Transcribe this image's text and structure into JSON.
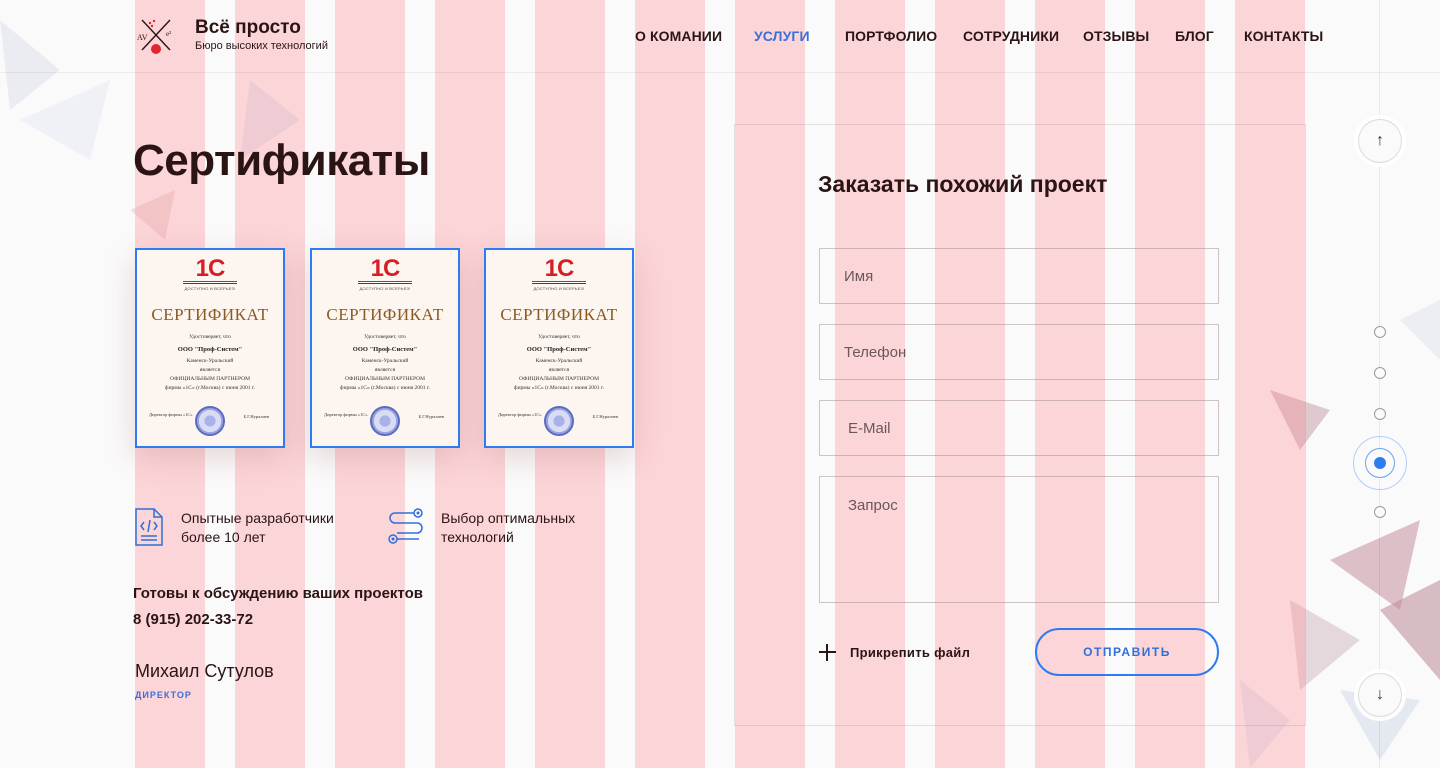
{
  "brand": {
    "title": "Всё просто",
    "subtitle": "Бюро высоких технологий"
  },
  "nav": {
    "items": [
      {
        "label": "О КОМАНИИ",
        "active": false
      },
      {
        "label": "УСЛУГИ",
        "active": true
      },
      {
        "label": "ПОРТФОЛИО",
        "active": false
      },
      {
        "label": "СОТРУДНИКИ",
        "active": false
      },
      {
        "label": "ОТЗЫВЫ",
        "active": false
      },
      {
        "label": "БЛОГ",
        "active": false
      },
      {
        "label": "КОНТАКТЫ",
        "active": false
      }
    ]
  },
  "page": {
    "title": "Сертификаты"
  },
  "certificates": [
    {
      "logo": "1С",
      "tagline": "ДОСТУПНО И ВСЕРЬЕЗ!",
      "heading": "СЕРТИФИКАТ",
      "line1": "Удостоверяет, что",
      "company": "ООО \"Проф-Систем\"",
      "city": "Каменск-Уральский",
      "line2": "является",
      "status": "ОФИЦИАЛЬНЫМ ПАРТНЕРОМ",
      "line3": "фирмы «1С» (г.Москва) с июня 2001 г.",
      "signer_role": "Директор фирмы «1С»",
      "signer_name": "Б.Г.Нуралиев"
    },
    {
      "logo": "1С",
      "tagline": "ДОСТУПНО И ВСЕРЬЕЗ!",
      "heading": "СЕРТИФИКАТ",
      "line1": "Удостоверяет, что",
      "company": "ООО \"Проф-Систем\"",
      "city": "Каменск-Уральский",
      "line2": "является",
      "status": "ОФИЦИАЛЬНЫМ ПАРТНЕРОМ",
      "line3": "фирмы «1С» (г.Москва) с июня 2001 г.",
      "signer_role": "Директор фирмы «1С»",
      "signer_name": "Б.Г.Нуралиев"
    },
    {
      "logo": "1С",
      "tagline": "ДОСТУПНО И ВСЕРЬЕЗ!",
      "heading": "СЕРТИФИКАТ",
      "line1": "Удостоверяет, что",
      "company": "ООО \"Проф-Систем\"",
      "city": "Каменск-Уральский",
      "line2": "является",
      "status": "ОФИЦИАЛЬНЫМ ПАРТНЕРОМ",
      "line3": "фирмы «1С» (г.Москва) с июня 2001 г.",
      "signer_role": "Директор фирмы «1С»",
      "signer_name": "Б.Г.Нуралиев"
    }
  ],
  "features": [
    {
      "icon": "code-document-icon",
      "line1": "Опытные разработчики",
      "line2": "более 10 лет"
    },
    {
      "icon": "connections-icon",
      "line1": "Выбор оптимальных",
      "line2": "технологий"
    }
  ],
  "contact": {
    "ready_text": "Готовы к обсуждению ваших проектов",
    "phone": "8 (915) 202-33-72",
    "person_name": "Михаил Сутулов",
    "person_role": "ДИРЕКТОР"
  },
  "form": {
    "title": "Заказать похожий проект",
    "name_placeholder": "Имя",
    "phone_placeholder": "Телефон",
    "email_placeholder": "E-Mail",
    "request_placeholder": "Запрос",
    "name_value": "",
    "phone_value": "",
    "email_value": "",
    "request_value": "",
    "attach_label": "Прикрепить файл",
    "submit_label": "ОТПРАВИТЬ"
  },
  "side_nav": {
    "up_icon": "arrow-up-icon",
    "down_icon": "arrow-down-icon",
    "up_glyph": "↑",
    "down_glyph": "↓",
    "dots_count": 5,
    "active_dot": 4
  },
  "colors": {
    "accent": "#2f7bf0",
    "active_nav": "#3a6fd8",
    "text": "#2a1414",
    "stripe": "#ffd3d6"
  }
}
